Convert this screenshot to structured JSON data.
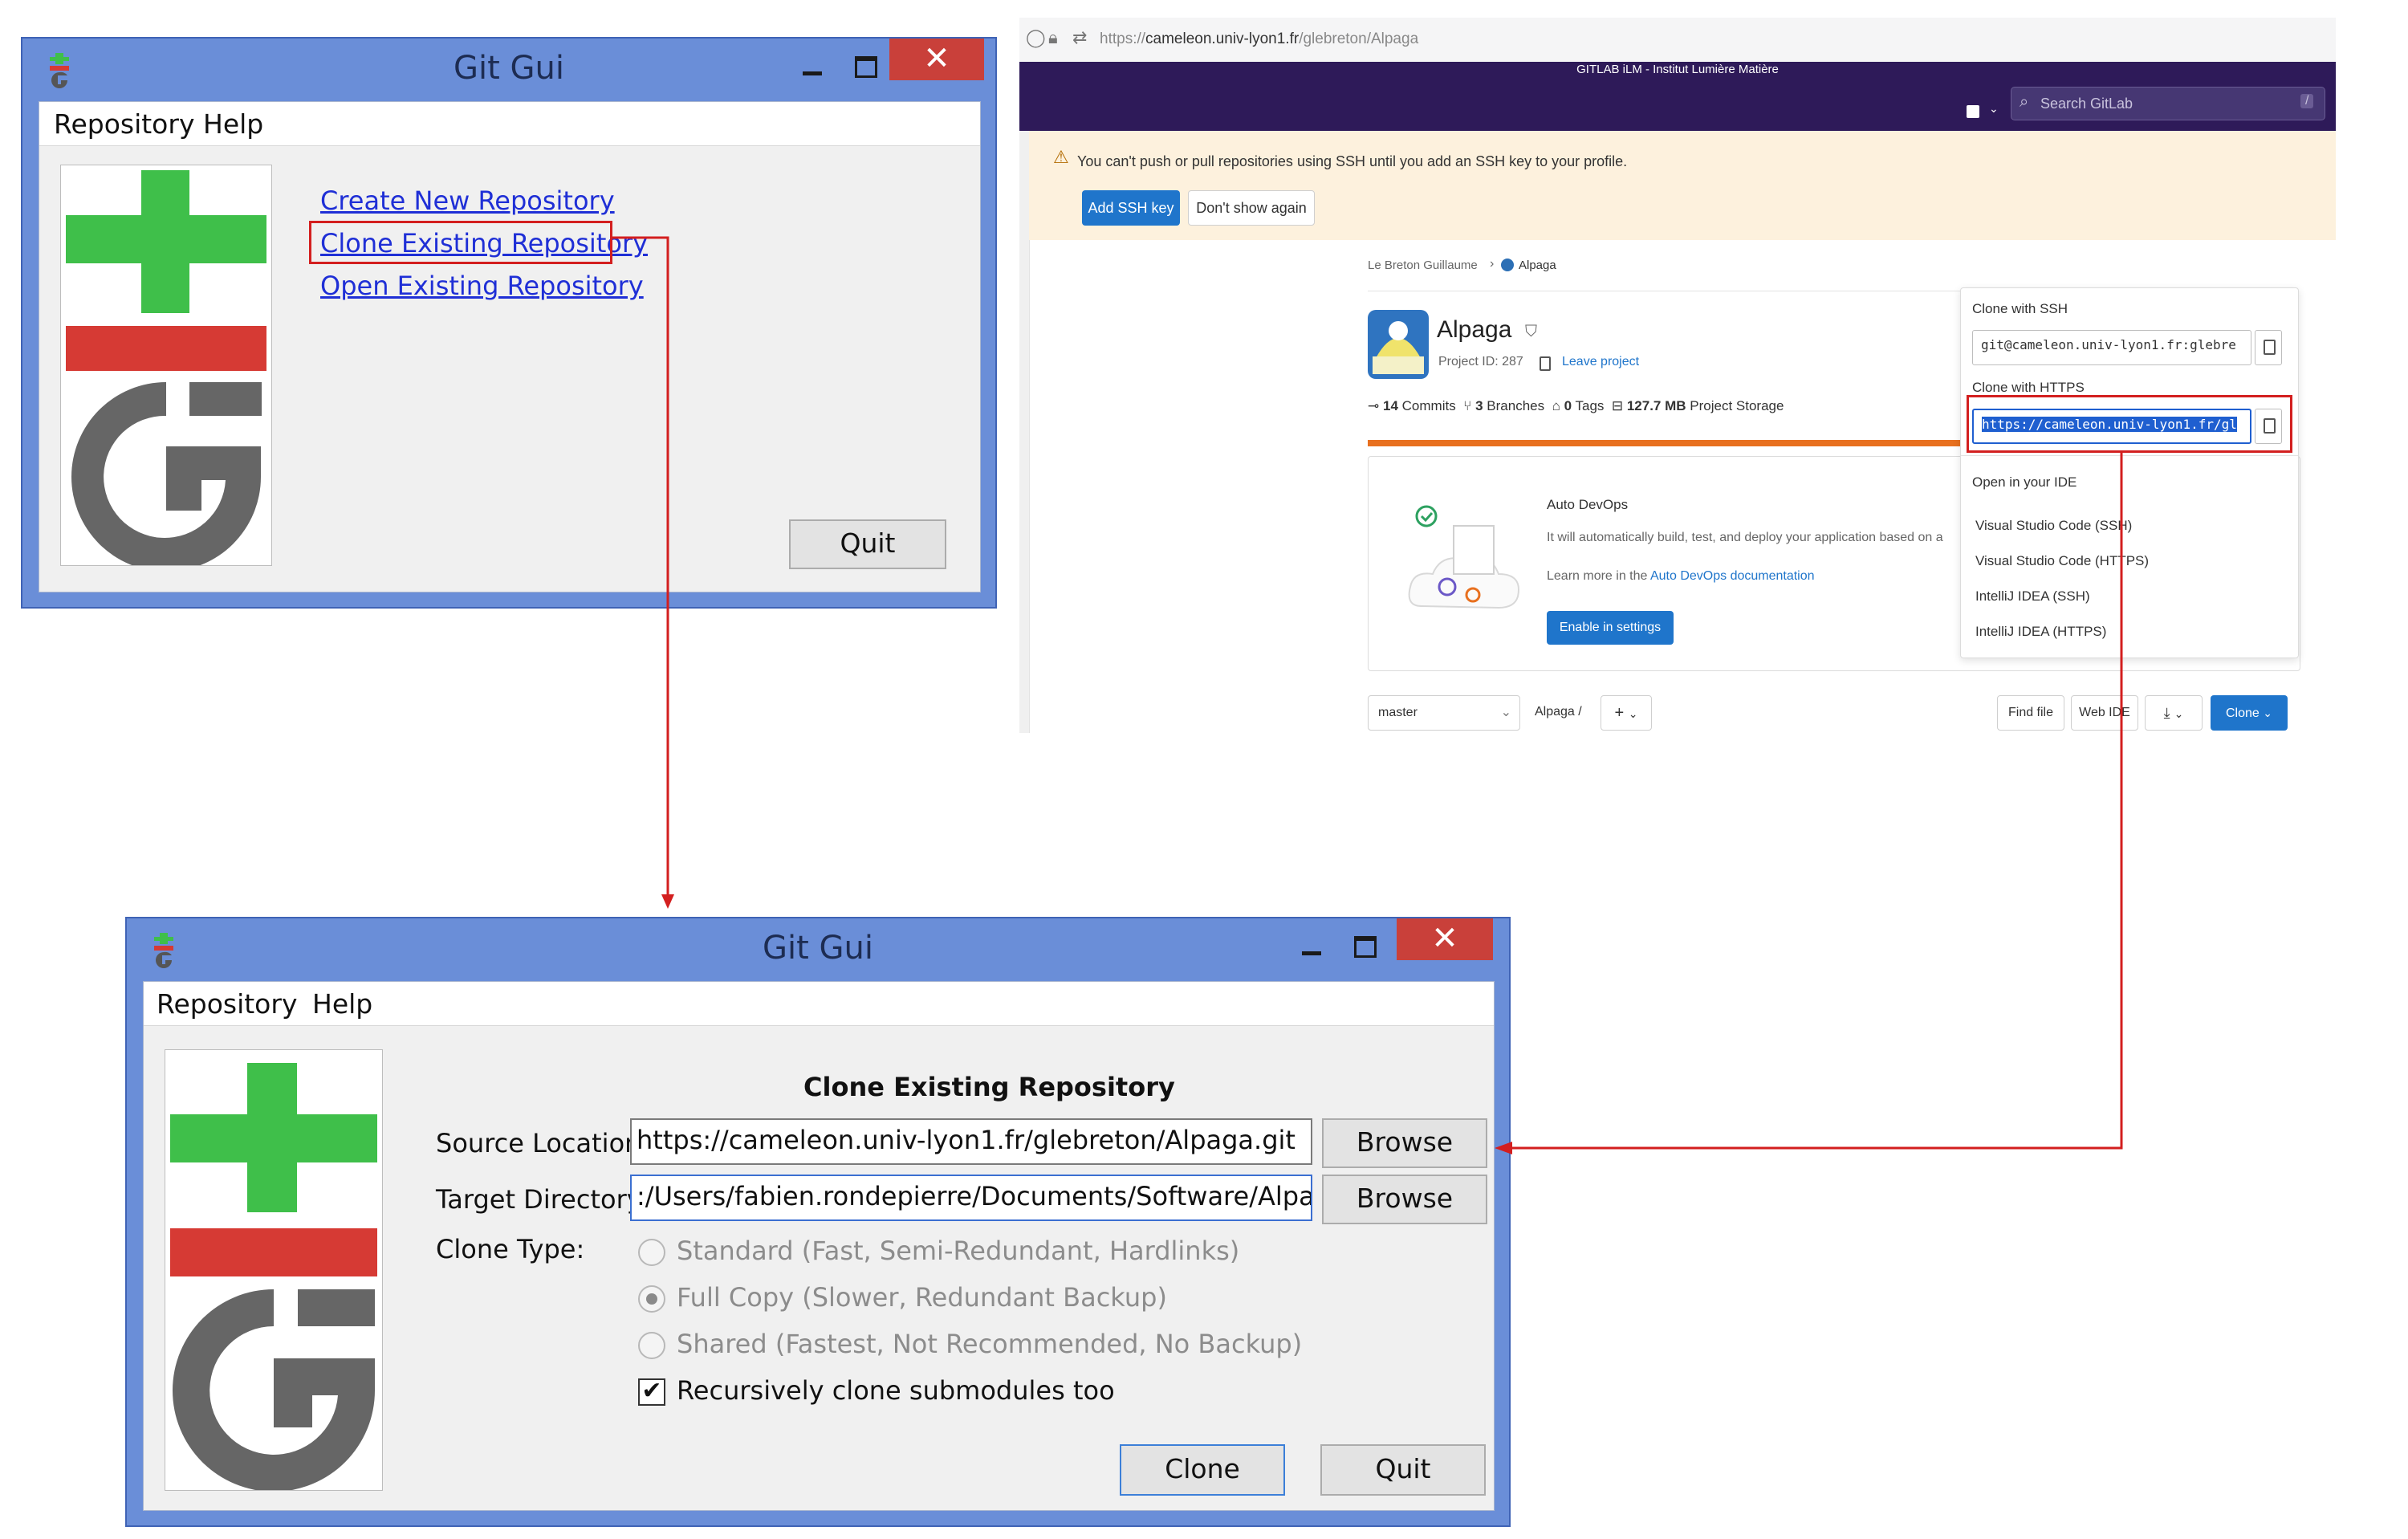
{
  "gitgui": {
    "title": "Git Gui",
    "close_glyph": "✕",
    "menu": [
      "Repository",
      "Help"
    ],
    "links": {
      "create": "Create New Repository",
      "clone": "Clone Existing Repository",
      "open": "Open Existing Repository"
    },
    "quit": "Quit"
  },
  "clone_dialog": {
    "title": "Git Gui",
    "close_glyph": "✕",
    "menu": [
      "Repository",
      "Help"
    ],
    "heading": "Clone Existing Repository",
    "source_label": "Source Location:",
    "source_value": "https://cameleon.univ-lyon1.fr/glebreton/Alpaga.git",
    "target_label": "Target Directory:",
    "target_value": ":/Users/fabien.rondepierre/Documents/Software/Alpaga",
    "browse": "Browse",
    "clone_type_label": "Clone Type:",
    "options": [
      "Standard (Fast, Semi-Redundant, Hardlinks)",
      "Full Copy (Slower, Redundant Backup)",
      "Shared (Fastest, Not Recommended, No Backup)"
    ],
    "selected_option": 1,
    "recursive_label": "Recursively clone submodules too",
    "recursive_checked": true,
    "check_glyph": "✔",
    "clone_button": "Clone",
    "quit_button": "Quit"
  },
  "gitlab": {
    "url_prefix": "https://",
    "url_host": "cameleon.univ-lyon1.fr",
    "url_path": "/glebreton/Alpaga",
    "banner": "GITLAB iLM - Institut Lumière Matière",
    "search_placeholder": "Search GitLab",
    "search_shortcut": "/",
    "warning": "You can't push or pull repositories using SSH until you add an SSH key to your profile.",
    "add_ssh_key": "Add SSH key",
    "dont_show": "Don't show again",
    "breadcrumb": [
      "Le Breton Guillaume",
      "Alpaga"
    ],
    "project_name": "Alpaga",
    "project_id": "Project ID: 287",
    "leave_project": "Leave project",
    "stats": {
      "commits_count": "14",
      "commits_label": "Commits",
      "branches_count": "3",
      "branches_label": "Branches",
      "tags_count": "0",
      "tags_label": "Tags",
      "storage_size": "127.7 MB",
      "storage_label": "Project Storage"
    },
    "devops": {
      "title": "Auto DevOps",
      "desc": "It will automatically build, test, and deploy your application based on a",
      "learn_prefix": "Learn more in the ",
      "learn_link": "Auto DevOps documentation",
      "enable": "Enable in settings"
    },
    "branch": "master",
    "path_root": "Alpaga",
    "path_sep": "/",
    "add_glyph": "+",
    "find_file": "Find file",
    "web_ide": "Web IDE",
    "clone_button": "Clone",
    "clone_dropdown": {
      "ssh_heading": "Clone with SSH",
      "ssh_url": "git@cameleon.univ-lyon1.fr:glebre",
      "https_heading": "Clone with HTTPS",
      "https_url": "https://cameleon.univ-lyon1.fr/gl",
      "ide_heading": "Open in your IDE",
      "ide_items": [
        "Visual Studio Code (SSH)",
        "Visual Studio Code (HTTPS)",
        "IntelliJ IDEA (SSH)",
        "IntelliJ IDEA (HTTPS)"
      ]
    }
  },
  "colors": {
    "annotation_red": "#d31f1f",
    "gitlab_purple": "#2e1a59",
    "gitlab_blue": "#1f75cb",
    "git_green": "#3fbf4a",
    "git_red": "#d63a34",
    "git_gray": "#666666"
  }
}
